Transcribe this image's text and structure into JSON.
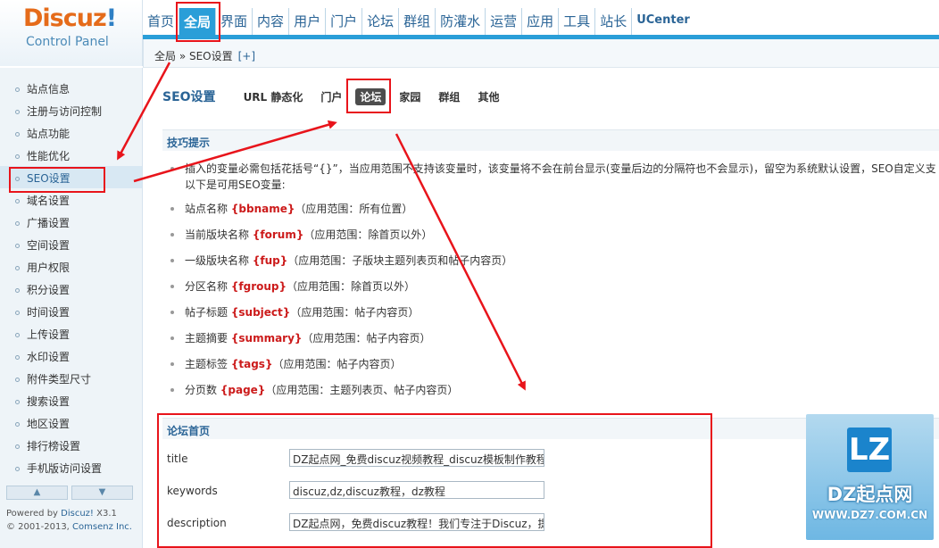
{
  "logo": {
    "brand_main": "Discuz",
    "brand_bang": "!",
    "subtitle": "Control Panel"
  },
  "topnav": {
    "items": [
      "首页",
      "全局",
      "界面",
      "内容",
      "用户",
      "门户",
      "论坛",
      "群组",
      "防灌水",
      "运营",
      "应用",
      "工具",
      "站长",
      "UCenter"
    ],
    "active": "全局"
  },
  "breadcrumb": {
    "text": "全局 » SEO设置",
    "plus": "[+]"
  },
  "sidebar": {
    "items": [
      "站点信息",
      "注册与访问控制",
      "站点功能",
      "性能优化",
      "SEO设置",
      "域名设置",
      "广播设置",
      "空间设置",
      "用户权限",
      "积分设置",
      "时间设置",
      "上传设置",
      "水印设置",
      "附件类型尺寸",
      "搜索设置",
      "地区设置",
      "排行榜设置",
      "手机版访问设置"
    ],
    "active": "SEO设置",
    "scroll_up": "▲",
    "scroll_down": "▼",
    "footer_line1_prefix": "Powered by ",
    "footer_line1_link": "Discuz!",
    "footer_line1_suffix": " X3.1",
    "footer_line2_prefix": "© 2001-2013, ",
    "footer_line2_link": "Comsenz Inc."
  },
  "subnav": {
    "title": "SEO设置",
    "tabs": [
      "URL 静态化",
      "门户",
      "论坛",
      "家园",
      "群组",
      "其他"
    ],
    "active": "论坛"
  },
  "tips": {
    "header": "技巧提示",
    "intro_line1": "插入的变量必需包括花括号“{}”，当应用范围不支持该变量时，该变量将不会在前台显示(变量后边的分隔符也不会显示)，留空为系统默认设置，SEO自定义支",
    "intro_line2": "以下是可用SEO变量:",
    "vars": [
      {
        "name": "站点名称",
        "var": "{bbname}",
        "scope": "（应用范围：所有位置）"
      },
      {
        "name": "当前版块名称",
        "var": "{forum}",
        "scope": "（应用范围：除首页以外）"
      },
      {
        "name": "一级版块名称",
        "var": "{fup}",
        "scope": "（应用范围：子版块主题列表页和帖子内容页）"
      },
      {
        "name": "分区名称",
        "var": "{fgroup}",
        "scope": "（应用范围：除首页以外）"
      },
      {
        "name": "帖子标题",
        "var": "{subject}",
        "scope": "（应用范围：帖子内容页）"
      },
      {
        "name": "主题摘要",
        "var": "{summary}",
        "scope": "（应用范围：帖子内容页）"
      },
      {
        "name": "主题标签",
        "var": "{tags}",
        "scope": "（应用范围：帖子内容页）"
      },
      {
        "name": "分页数",
        "var": "{page}",
        "scope": "（应用范围：主题列表页、帖子内容页）"
      }
    ]
  },
  "forum_home": {
    "header": "论坛首页",
    "fields": [
      {
        "label": "title",
        "value": "DZ起点网_免费discuz视频教程_discuz模板制作教程"
      },
      {
        "label": "keywords",
        "value": "discuz,dz,discuz教程，dz教程"
      },
      {
        "label": "description",
        "value": "DZ起点网，免费discuz教程！我们专注于Discuz，提"
      }
    ]
  },
  "watermark": {
    "logo": "LZ",
    "name": "DZ起点网",
    "url": "WWW.DZ7.COM.CN"
  },
  "colors": {
    "accent": "#2a9ed8",
    "annotation": "#e8141b",
    "var_red": "#cc1b1b"
  }
}
